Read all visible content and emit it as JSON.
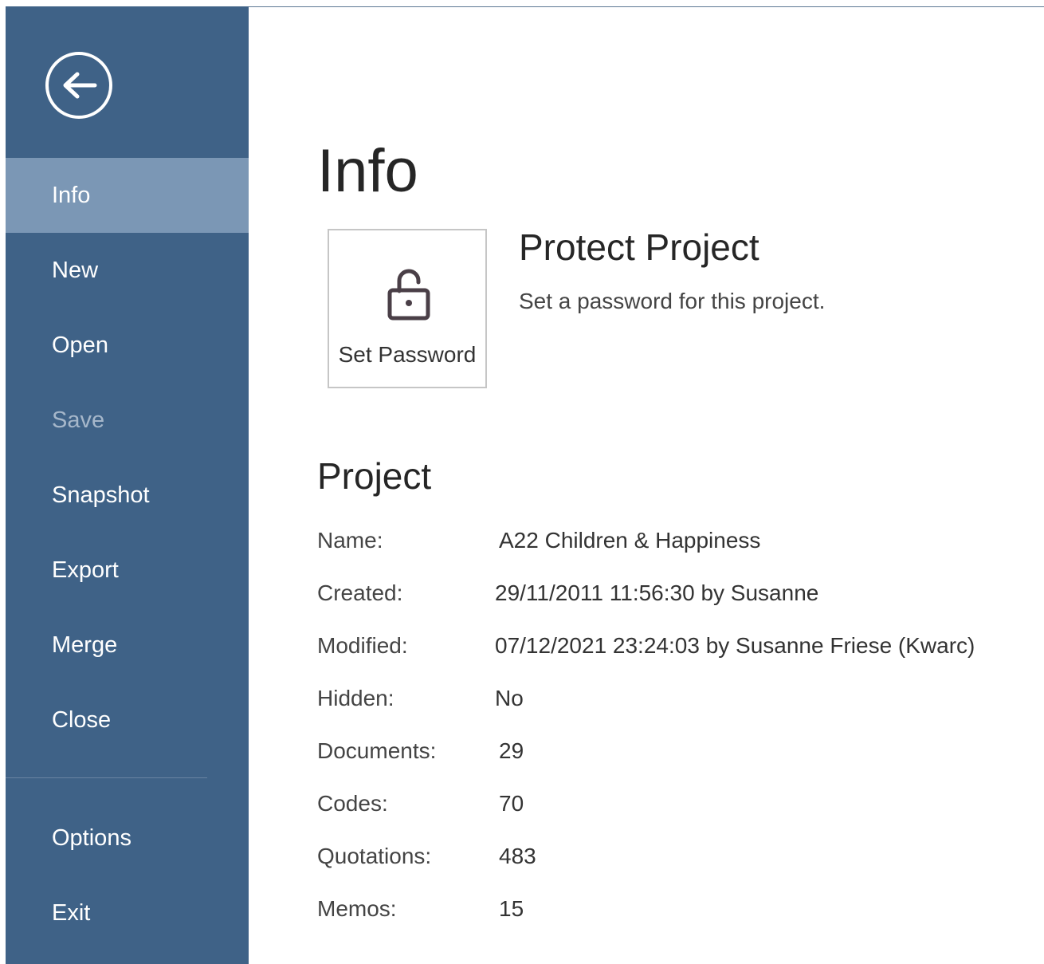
{
  "sidebar": {
    "back_icon": "arrow-left-circle-icon",
    "colors": {
      "background": "#3f6287",
      "active_item": "#7b97b5",
      "text": "#ffffff",
      "disabled_text": "#a6b7ca"
    },
    "items": [
      {
        "id": "info",
        "label": "Info",
        "active": true,
        "enabled": true
      },
      {
        "id": "new",
        "label": "New",
        "active": false,
        "enabled": true
      },
      {
        "id": "open",
        "label": "Open",
        "active": false,
        "enabled": true
      },
      {
        "id": "save",
        "label": "Save",
        "active": false,
        "enabled": false
      },
      {
        "id": "snapshot",
        "label": "Snapshot",
        "active": false,
        "enabled": true
      },
      {
        "id": "export",
        "label": "Export",
        "active": false,
        "enabled": true
      },
      {
        "id": "merge",
        "label": "Merge",
        "active": false,
        "enabled": true
      },
      {
        "id": "close",
        "label": "Close",
        "active": false,
        "enabled": true
      }
    ],
    "footer_items": [
      {
        "id": "options",
        "label": "Options",
        "enabled": true
      },
      {
        "id": "exit",
        "label": "Exit",
        "enabled": true
      }
    ]
  },
  "main": {
    "title": "Info",
    "protect": {
      "button_label": "Set Password",
      "button_icon": "unlocked-padlock-icon",
      "title": "Protect Project",
      "description": "Set a password for this project."
    },
    "project": {
      "title": "Project",
      "fields": [
        {
          "label": "Name:",
          "value": "A22 Children & Happiness"
        },
        {
          "label": "Created:",
          "value": "29/11/2011 11:56:30 by Susanne"
        },
        {
          "label": "Modified:",
          "value": "07/12/2021 23:24:03 by Susanne Friese (Kwarc)"
        },
        {
          "label": "Hidden:",
          "value": "No"
        },
        {
          "label": "Documents:",
          "value": "29"
        },
        {
          "label": "Codes:",
          "value": "70"
        },
        {
          "label": "Quotations:",
          "value": "483"
        },
        {
          "label": "Memos:",
          "value": "15"
        }
      ]
    }
  }
}
